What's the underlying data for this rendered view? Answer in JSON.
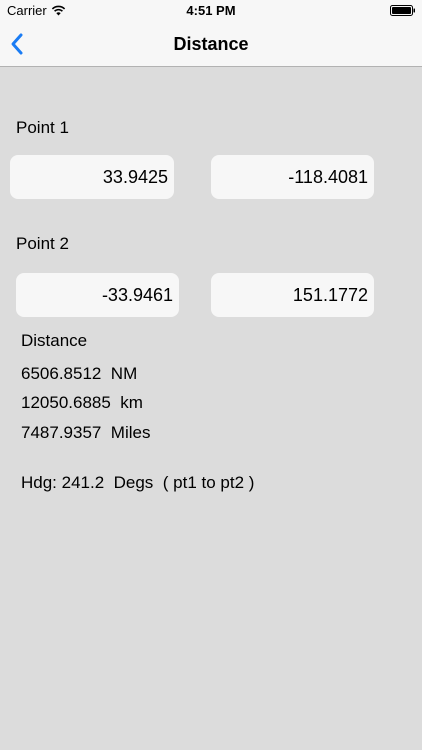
{
  "status_bar": {
    "carrier": "Carrier",
    "time": "4:51 PM"
  },
  "nav": {
    "title": "Distance",
    "back_icon": "chevron-left-icon"
  },
  "point1": {
    "label": "Point 1",
    "lat": "33.9425",
    "lon": "-118.4081"
  },
  "point2": {
    "label": "Point 2",
    "lat": "-33.9461",
    "lon": "151.1772"
  },
  "results": {
    "heading": "Distance",
    "nm": "6506.8512  NM",
    "km": "12050.6885  km",
    "miles": "7487.9357  Miles",
    "hdg": "Hdg: 241.2  Degs  ( pt1 to pt2 )"
  },
  "colors": {
    "accent": "#1a7cf4",
    "background": "#dcdcdc",
    "field_background": "#f7f7f7"
  }
}
